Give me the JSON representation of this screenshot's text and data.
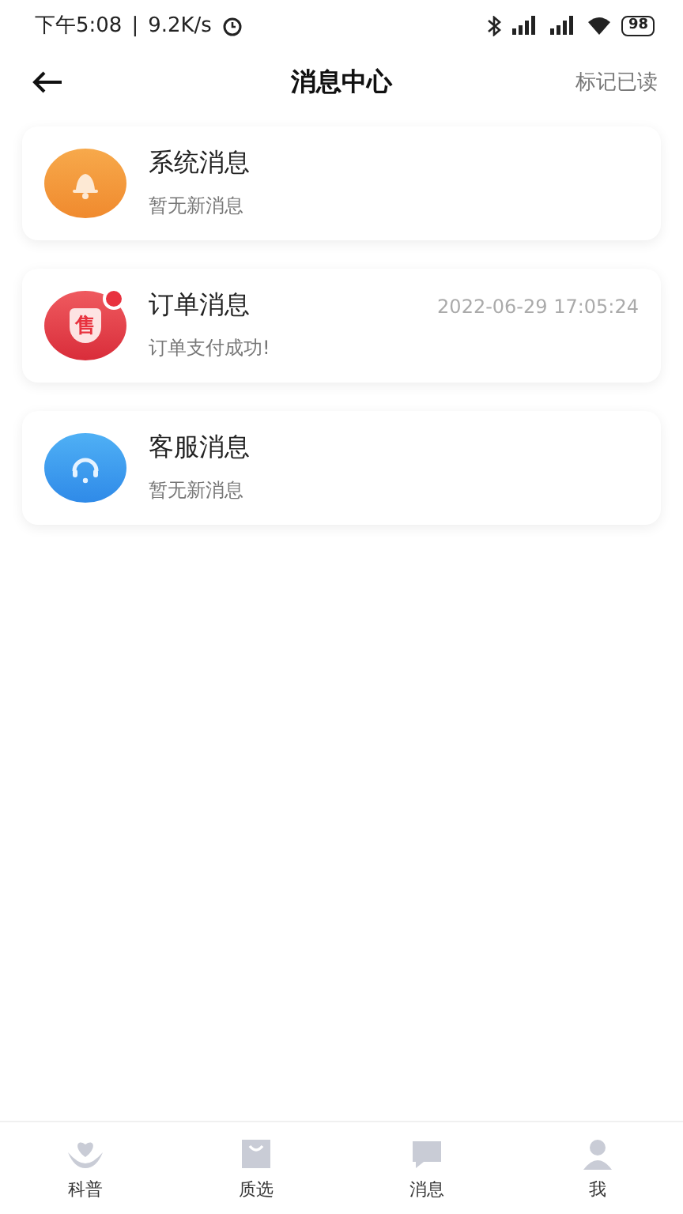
{
  "status_bar": {
    "time": "下午5:08",
    "divider": "|",
    "speed": "9.2K/s",
    "battery": "98"
  },
  "header": {
    "title": "消息中心",
    "action": "标记已读"
  },
  "messages": [
    {
      "kind": "system",
      "title": "系统消息",
      "subtitle": "暂无新消息",
      "unread": false
    },
    {
      "kind": "order",
      "badge": "售",
      "title": "订单消息",
      "time": "2022-06-29 17:05:24",
      "subtitle": "订单支付成功!",
      "unread": true
    },
    {
      "kind": "service",
      "title": "客服消息",
      "subtitle": "暂无新消息",
      "unread": false
    }
  ],
  "tab_bar": [
    {
      "kind": "science",
      "label": "科普",
      "selected": false
    },
    {
      "kind": "shop",
      "label": "质选",
      "selected": false
    },
    {
      "kind": "message",
      "label": "消息",
      "selected": false
    },
    {
      "kind": "me",
      "label": "我",
      "selected": false
    }
  ]
}
